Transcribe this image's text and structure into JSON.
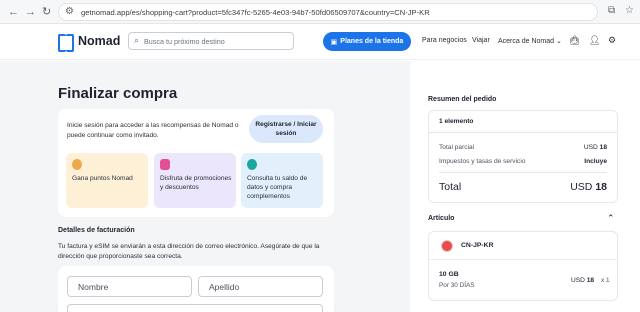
{
  "browser": {
    "url": "getnomad.app/es/shopping-cart?product=5fc347fc-5265-4e03-94b7-50fd06509707&country=CN-JP-KR",
    "icons": [
      "back-icon",
      "forward-icon",
      "reload-icon",
      "tune-icon",
      "cast-icon",
      "star-icon"
    ]
  },
  "header": {
    "brand": "Nomad",
    "search_placeholder": "Busca tu próximo destino",
    "plans_button": "Planes de la tienda",
    "links": [
      "Para negocios",
      "Viajar",
      "Acerca de Nomad"
    ]
  },
  "checkout": {
    "title": "Finalizar compra",
    "intro": "Inicie sesión para acceder a las recompensas de Nomad o puede continuar como invitado.",
    "register_button": "Registrarse / Iniciar sesión",
    "perks": [
      {
        "label": "Gana puntos Nomad",
        "color": "#f0a94a"
      },
      {
        "label": "Disfruta de promociones y descuentos",
        "color": "#e44f93"
      },
      {
        "label": "Consulta tu saldo de datos y compra complementos",
        "color": "#1aa7a0"
      }
    ],
    "billing_title": "Detalles de facturación",
    "billing_desc": "Tu factura y eSIM se enviarán a esta dirección de correo electrónico. Asegúrate de que la dirección que proporcionaste sea correcta.",
    "first_name_placeholder": "Nombre",
    "last_name_placeholder": "Apellido"
  },
  "summary": {
    "title": "Resumen del pedido",
    "items_count": "1 elemento",
    "subtotal_label": "Total parcial",
    "subtotal_currency": "USD",
    "subtotal_value": "18",
    "tax_label": "Impuestos y tasas de servicio",
    "tax_value": "Incluye",
    "total_label": "Total",
    "total_currency": "USD",
    "total_value": "18",
    "article_label": "Artículo",
    "product_name": "CN-JP-KR",
    "product_data": "10 GB",
    "product_days": "Por 30 DÍAS",
    "product_currency": "USD",
    "product_price": "18",
    "product_qty": "x 1"
  },
  "colors": {
    "accent": "#1b74e8",
    "left_bg": "#f4f5f7"
  }
}
